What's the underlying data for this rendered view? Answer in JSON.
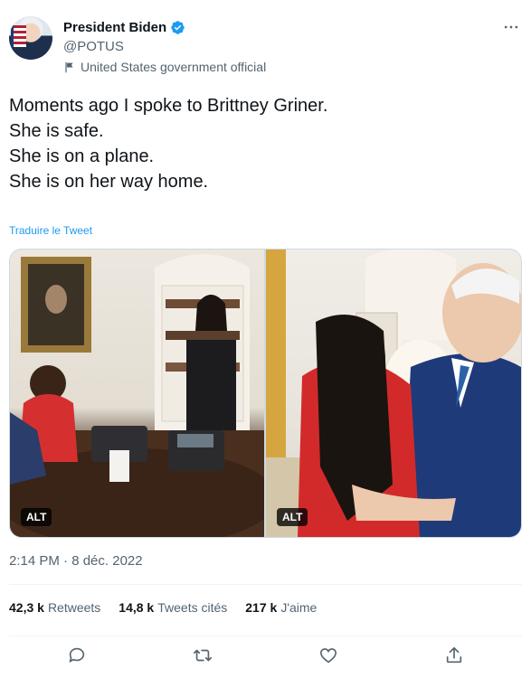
{
  "author": {
    "name": "President Biden",
    "handle": "@POTUS",
    "label": "United States government official"
  },
  "icons": {
    "verified": "verified-badge-icon",
    "more": "more-options-icon",
    "flag": "government-flag-icon",
    "reply": "reply-icon",
    "retweet": "retweet-icon",
    "like": "like-icon",
    "share": "share-icon"
  },
  "tweet": {
    "lines": [
      "Moments ago I spoke to Brittney Griner.",
      "",
      "She is safe.",
      "She is on a plane.",
      "She is on her way home."
    ],
    "translate_label": "Traduire le Tweet"
  },
  "media": [
    {
      "alt_badge": "ALT"
    },
    {
      "alt_badge": "ALT"
    }
  ],
  "timestamp": "2:14 PM · 8 déc. 2022",
  "stats": {
    "retweets": {
      "count": "42,3 k",
      "label": "Retweets"
    },
    "quotes": {
      "count": "14,8 k",
      "label": "Tweets cités"
    },
    "likes": {
      "count": "217 k",
      "label": "J'aime"
    }
  },
  "colors": {
    "link": "#1d9bf0",
    "secondary_text": "#536471",
    "primary_text": "#0f1419"
  }
}
